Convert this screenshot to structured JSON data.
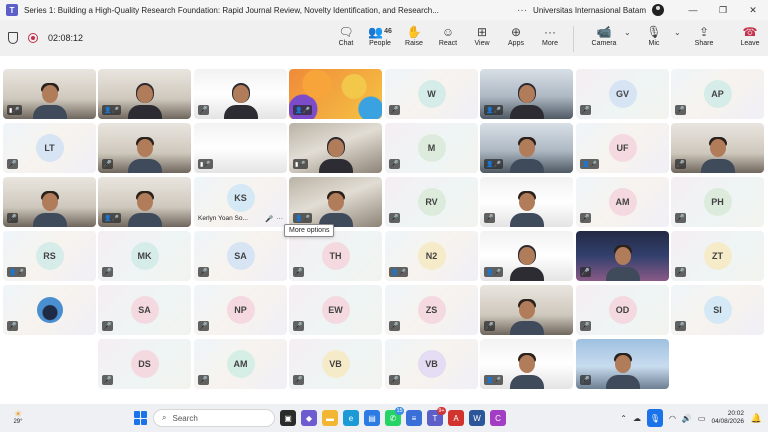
{
  "window": {
    "title": "Series 1: Building a High-Quality Research Foundation: Rapid Journal Review, Novelty Identification, and Research...",
    "more": "···",
    "organization": "Universitas Internasional Batam",
    "minimize": "—",
    "restore": "❐",
    "close": "✕"
  },
  "meeting": {
    "timer": "02:08:12",
    "participant_count": "46",
    "buttons": {
      "chat": "Chat",
      "people": "People",
      "raise": "Raise",
      "react": "React",
      "view": "View",
      "apps": "Apps",
      "more": "More",
      "camera": "Camera",
      "mic": "Mic",
      "share": "Share",
      "leave": "Leave"
    },
    "tooltip": "More options"
  },
  "tiles": [
    {
      "initials": ""
    },
    {
      "initials": ""
    },
    {
      "initials": ""
    },
    {
      "initials": ""
    },
    {
      "initials": "W"
    },
    {
      "initials": ""
    },
    {
      "initials": "GV"
    },
    {
      "initials": "AP"
    },
    {
      "initials": "LT"
    },
    {
      "initials": ""
    },
    {
      "initials": ""
    },
    {
      "initials": ""
    },
    {
      "initials": "M"
    },
    {
      "initials": ""
    },
    {
      "initials": "UF"
    },
    {
      "initials": ""
    },
    {
      "initials": ""
    },
    {
      "initials": ""
    },
    {
      "initials": "KS",
      "name": "Kerlyn Yoan So..."
    },
    {
      "initials": ""
    },
    {
      "initials": "RV"
    },
    {
      "initials": ""
    },
    {
      "initials": "AM"
    },
    {
      "initials": "PH"
    },
    {
      "initials": "RS"
    },
    {
      "initials": "MK"
    },
    {
      "initials": "SA"
    },
    {
      "initials": "TH"
    },
    {
      "initials": "N2"
    },
    {
      "initials": ""
    },
    {
      "initials": ""
    },
    {
      "initials": "ZT"
    },
    {
      "initials": ""
    },
    {
      "initials": "SA"
    },
    {
      "initials": "NP"
    },
    {
      "initials": "EW"
    },
    {
      "initials": "ZS"
    },
    {
      "initials": ""
    },
    {
      "initials": "OD"
    },
    {
      "initials": "SI"
    },
    {
      "initials": "DS"
    },
    {
      "initials": "AM"
    },
    {
      "initials": "VB"
    },
    {
      "initials": "VB"
    },
    {
      "initials": ""
    },
    {
      "initials": ""
    }
  ],
  "taskbar": {
    "temperature": "29°",
    "search_placeholder": "Search",
    "whatsapp_badge": "15",
    "teams_badge": "9+",
    "time": "20:02",
    "date": "04/08/2026"
  }
}
